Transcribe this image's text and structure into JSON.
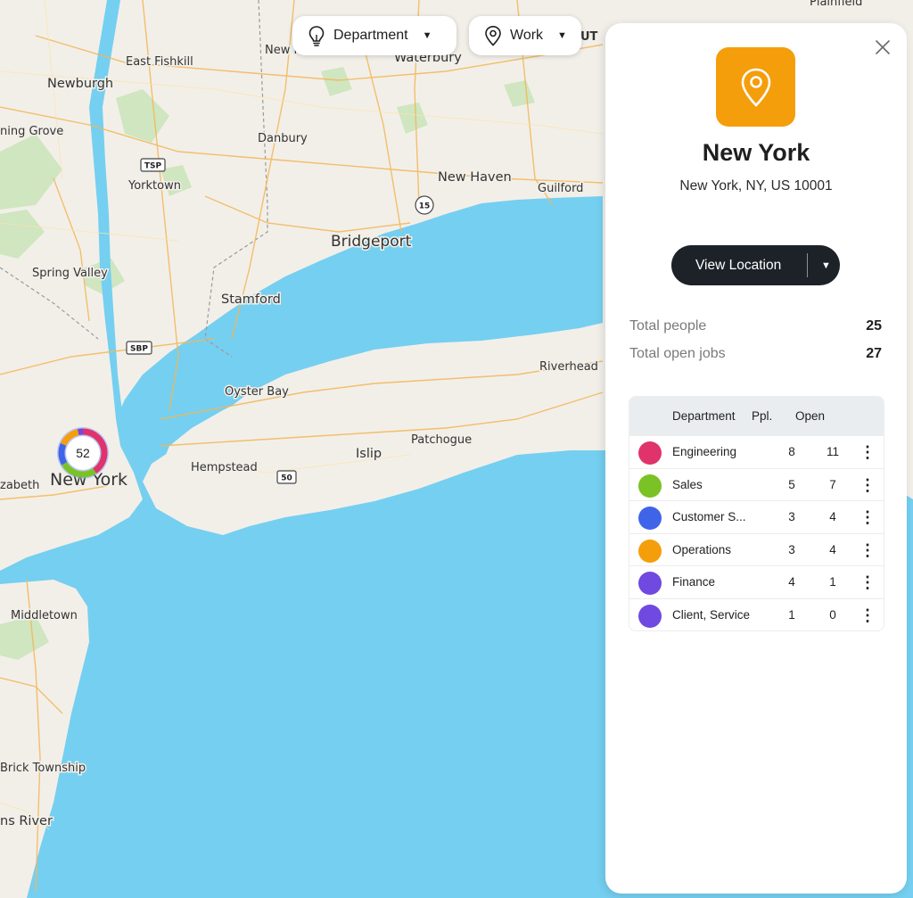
{
  "map": {
    "labels": {
      "plainfield": "Plainfield",
      "new_m": "New M",
      "waterbury": "Waterbury",
      "east_fishkill": "East Fishkill",
      "newburgh": "Newburgh",
      "danbury": "Danbury",
      "ning_grove": "ning Grove",
      "new_haven": "New Haven",
      "guilford": "Guilford",
      "yorktown": "Yorktown",
      "bridgeport": "Bridgeport",
      "spring_valley": "Spring Valley",
      "stamford": "Stamford",
      "riverhead": "Riverhead",
      "oyster_bay": "Oyster Bay",
      "patchogue": "Patchogue",
      "islip": "Islip",
      "hempstead": "Hempstead",
      "new_york": "New York",
      "zabeth": "zabeth",
      "middletown": "Middletown",
      "brick_township": "Brick Township",
      "ns_river": "ns River",
      "edge_ut": "UT"
    },
    "shields": {
      "tsp": "TSP",
      "route15": "15",
      "sbp": "SBP",
      "route50": "50"
    },
    "cluster": {
      "count": "52",
      "segments": [
        {
          "color": "#e0336b",
          "value": 11
        },
        {
          "color": "#7ac226",
          "value": 7
        },
        {
          "color": "#4064e8",
          "value": 4
        },
        {
          "color": "#f59e0b",
          "value": 4
        },
        {
          "color": "#6f49e0",
          "value": 1
        }
      ]
    }
  },
  "filters": {
    "department": {
      "label": "Department",
      "icon": "lightbulb-icon"
    },
    "work": {
      "label": "Work",
      "icon": "location-pin-icon"
    }
  },
  "panel": {
    "title": "New York",
    "address": "New York, NY, US 10001",
    "icon": "location-pin-icon",
    "accent": "#f59e0b",
    "view_button": "View Location",
    "stats": {
      "people_label": "Total people",
      "people_value": "25",
      "jobs_label": "Total open jobs",
      "jobs_value": "27"
    },
    "table": {
      "headers": {
        "department": "Department",
        "ppl": "Ppl.",
        "open": "Open"
      },
      "rows": [
        {
          "name": "Engineering",
          "ppl": "8",
          "open": "11",
          "color": "#e0336b"
        },
        {
          "name": "Sales",
          "ppl": "5",
          "open": "7",
          "color": "#7ac226"
        },
        {
          "name": "Customer S...",
          "ppl": "3",
          "open": "4",
          "color": "#4064e8"
        },
        {
          "name": "Operations",
          "ppl": "3",
          "open": "4",
          "color": "#f59e0b"
        },
        {
          "name": "Finance",
          "ppl": "4",
          "open": "1",
          "color": "#6f49e0"
        },
        {
          "name": "Client, Service",
          "ppl": "1",
          "open": "0",
          "color": "#6f49e0"
        }
      ]
    }
  }
}
